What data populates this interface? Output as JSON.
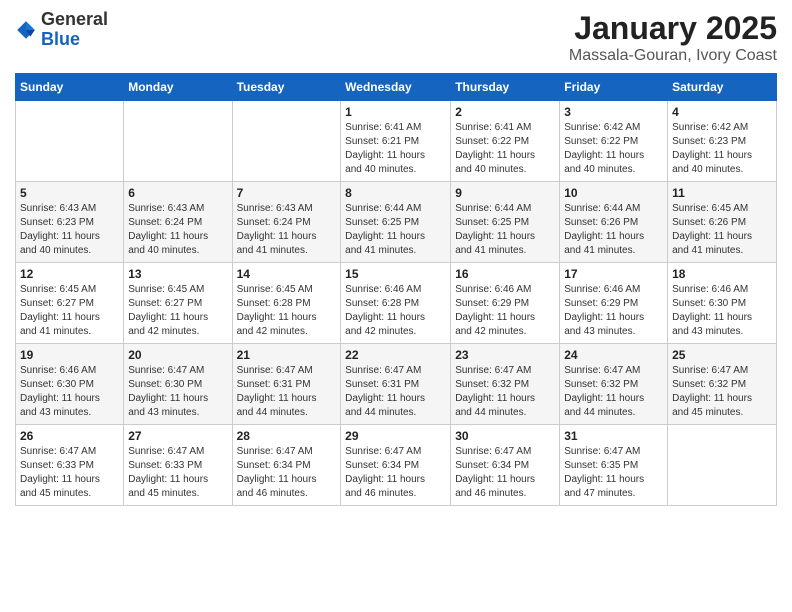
{
  "logo": {
    "general": "General",
    "blue": "Blue"
  },
  "header": {
    "month": "January 2025",
    "location": "Massala-Gouran, Ivory Coast"
  },
  "days": [
    "Sunday",
    "Monday",
    "Tuesday",
    "Wednesday",
    "Thursday",
    "Friday",
    "Saturday"
  ],
  "weeks": [
    [
      {
        "date": "",
        "info": ""
      },
      {
        "date": "",
        "info": ""
      },
      {
        "date": "",
        "info": ""
      },
      {
        "date": "1",
        "info": "Sunrise: 6:41 AM\nSunset: 6:21 PM\nDaylight: 11 hours\nand 40 minutes."
      },
      {
        "date": "2",
        "info": "Sunrise: 6:41 AM\nSunset: 6:22 PM\nDaylight: 11 hours\nand 40 minutes."
      },
      {
        "date": "3",
        "info": "Sunrise: 6:42 AM\nSunset: 6:22 PM\nDaylight: 11 hours\nand 40 minutes."
      },
      {
        "date": "4",
        "info": "Sunrise: 6:42 AM\nSunset: 6:23 PM\nDaylight: 11 hours\nand 40 minutes."
      }
    ],
    [
      {
        "date": "5",
        "info": "Sunrise: 6:43 AM\nSunset: 6:23 PM\nDaylight: 11 hours\nand 40 minutes."
      },
      {
        "date": "6",
        "info": "Sunrise: 6:43 AM\nSunset: 6:24 PM\nDaylight: 11 hours\nand 40 minutes."
      },
      {
        "date": "7",
        "info": "Sunrise: 6:43 AM\nSunset: 6:24 PM\nDaylight: 11 hours\nand 41 minutes."
      },
      {
        "date": "8",
        "info": "Sunrise: 6:44 AM\nSunset: 6:25 PM\nDaylight: 11 hours\nand 41 minutes."
      },
      {
        "date": "9",
        "info": "Sunrise: 6:44 AM\nSunset: 6:25 PM\nDaylight: 11 hours\nand 41 minutes."
      },
      {
        "date": "10",
        "info": "Sunrise: 6:44 AM\nSunset: 6:26 PM\nDaylight: 11 hours\nand 41 minutes."
      },
      {
        "date": "11",
        "info": "Sunrise: 6:45 AM\nSunset: 6:26 PM\nDaylight: 11 hours\nand 41 minutes."
      }
    ],
    [
      {
        "date": "12",
        "info": "Sunrise: 6:45 AM\nSunset: 6:27 PM\nDaylight: 11 hours\nand 41 minutes."
      },
      {
        "date": "13",
        "info": "Sunrise: 6:45 AM\nSunset: 6:27 PM\nDaylight: 11 hours\nand 42 minutes."
      },
      {
        "date": "14",
        "info": "Sunrise: 6:45 AM\nSunset: 6:28 PM\nDaylight: 11 hours\nand 42 minutes."
      },
      {
        "date": "15",
        "info": "Sunrise: 6:46 AM\nSunset: 6:28 PM\nDaylight: 11 hours\nand 42 minutes."
      },
      {
        "date": "16",
        "info": "Sunrise: 6:46 AM\nSunset: 6:29 PM\nDaylight: 11 hours\nand 42 minutes."
      },
      {
        "date": "17",
        "info": "Sunrise: 6:46 AM\nSunset: 6:29 PM\nDaylight: 11 hours\nand 43 minutes."
      },
      {
        "date": "18",
        "info": "Sunrise: 6:46 AM\nSunset: 6:30 PM\nDaylight: 11 hours\nand 43 minutes."
      }
    ],
    [
      {
        "date": "19",
        "info": "Sunrise: 6:46 AM\nSunset: 6:30 PM\nDaylight: 11 hours\nand 43 minutes."
      },
      {
        "date": "20",
        "info": "Sunrise: 6:47 AM\nSunset: 6:30 PM\nDaylight: 11 hours\nand 43 minutes."
      },
      {
        "date": "21",
        "info": "Sunrise: 6:47 AM\nSunset: 6:31 PM\nDaylight: 11 hours\nand 44 minutes."
      },
      {
        "date": "22",
        "info": "Sunrise: 6:47 AM\nSunset: 6:31 PM\nDaylight: 11 hours\nand 44 minutes."
      },
      {
        "date": "23",
        "info": "Sunrise: 6:47 AM\nSunset: 6:32 PM\nDaylight: 11 hours\nand 44 minutes."
      },
      {
        "date": "24",
        "info": "Sunrise: 6:47 AM\nSunset: 6:32 PM\nDaylight: 11 hours\nand 44 minutes."
      },
      {
        "date": "25",
        "info": "Sunrise: 6:47 AM\nSunset: 6:32 PM\nDaylight: 11 hours\nand 45 minutes."
      }
    ],
    [
      {
        "date": "26",
        "info": "Sunrise: 6:47 AM\nSunset: 6:33 PM\nDaylight: 11 hours\nand 45 minutes."
      },
      {
        "date": "27",
        "info": "Sunrise: 6:47 AM\nSunset: 6:33 PM\nDaylight: 11 hours\nand 45 minutes."
      },
      {
        "date": "28",
        "info": "Sunrise: 6:47 AM\nSunset: 6:34 PM\nDaylight: 11 hours\nand 46 minutes."
      },
      {
        "date": "29",
        "info": "Sunrise: 6:47 AM\nSunset: 6:34 PM\nDaylight: 11 hours\nand 46 minutes."
      },
      {
        "date": "30",
        "info": "Sunrise: 6:47 AM\nSunset: 6:34 PM\nDaylight: 11 hours\nand 46 minutes."
      },
      {
        "date": "31",
        "info": "Sunrise: 6:47 AM\nSunset: 6:35 PM\nDaylight: 11 hours\nand 47 minutes."
      },
      {
        "date": "",
        "info": ""
      }
    ]
  ]
}
